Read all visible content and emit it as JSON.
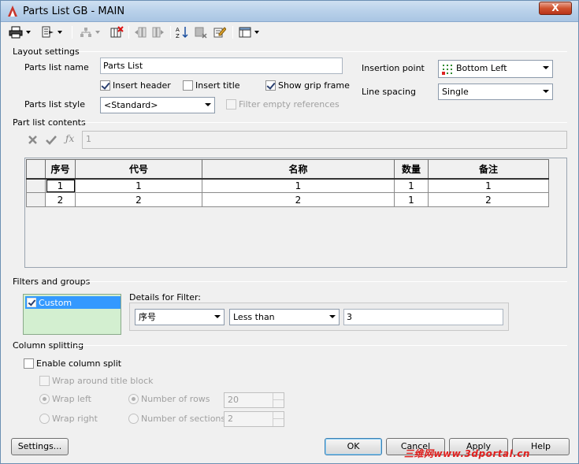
{
  "window": {
    "title": "Parts List GB - MAIN",
    "close_label": "X"
  },
  "toolbar": {
    "icons": [
      "printer-icon",
      "export-icon",
      "group-icon",
      "delete-column-icon",
      "column-left-icon",
      "column-right-icon",
      "sort-icon",
      "clear-icon",
      "edit-icon",
      "layout-icon"
    ],
    "formula_icons": [
      "cancel-x-icon",
      "accept-check-icon",
      "fx-icon"
    ]
  },
  "layout": {
    "title": "Layout settings",
    "parts_list_name_label": "Parts list name",
    "parts_list_name_value": "Parts List",
    "insert_header_label": "Insert header",
    "insert_header_checked": true,
    "insert_title_label": "Insert title",
    "insert_title_checked": false,
    "show_grip_frame_label": "Show grip frame",
    "show_grip_frame_checked": true,
    "parts_list_style_label": "Parts list style",
    "parts_list_style_value": "<Standard>",
    "filter_empty_label": "Filter empty references",
    "insertion_point_label": "Insertion point",
    "insertion_point_value": "Bottom Left",
    "line_spacing_label": "Line spacing",
    "line_spacing_value": "Single"
  },
  "contents": {
    "title": "Part list contents",
    "formula_value": "1",
    "columns": [
      "序号",
      "代号",
      "名称",
      "数量",
      "备注"
    ],
    "rows": [
      [
        "1",
        "1",
        "1",
        "1",
        "1"
      ],
      [
        "2",
        "2",
        "2",
        "1",
        "2"
      ]
    ]
  },
  "filters": {
    "title": "Filters and groups",
    "items": [
      {
        "label": "Custom",
        "checked": true
      }
    ],
    "details_label": "Details for Filter:",
    "field_value": "序号",
    "operator_value": "Less than",
    "criteria_value": "3"
  },
  "splitting": {
    "title": "Column splitting",
    "enable_label": "Enable column split",
    "wrap_title_label": "Wrap around title block",
    "wrap_left_label": "Wrap left",
    "wrap_right_label": "Wrap right",
    "rows_label": "Number of rows",
    "rows_value": "20",
    "sections_label": "Number of sections",
    "sections_value": "2"
  },
  "buttons": {
    "settings": "Settings...",
    "ok": "OK",
    "cancel": "Cancel",
    "apply": "Apply",
    "help": "Help"
  },
  "watermark": "三维网www.3dportal.cn",
  "colors": {
    "accent": "#3399ff",
    "filter_bg": "#d3efd0",
    "watermark": "#e0201e"
  }
}
